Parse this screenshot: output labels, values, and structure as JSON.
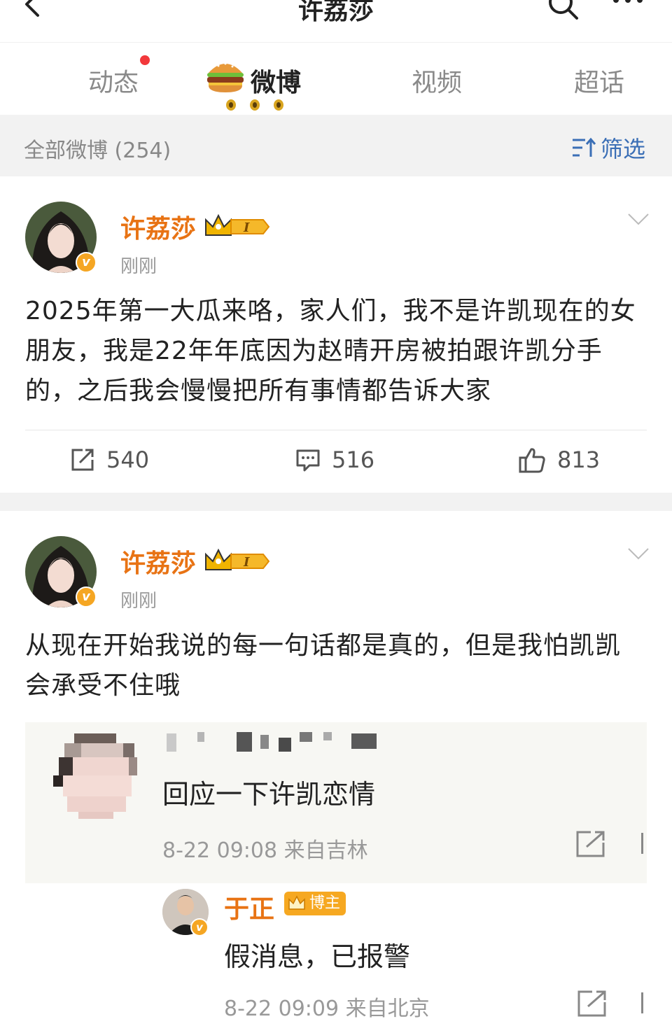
{
  "header": {
    "title": "许荔莎"
  },
  "tabs": [
    {
      "label": "动态",
      "has_dot": true
    },
    {
      "label": "微博",
      "active": true
    },
    {
      "label": "视频"
    },
    {
      "label": "超话"
    }
  ],
  "filterbar": {
    "count_label": "全部微博 (254)",
    "filter_label": "筛选"
  },
  "posts": [
    {
      "author": "许荔莎",
      "time": "刚刚",
      "text": "2025年第一大瓜来咯，家人们，我不是许凯现在的女朋友，我是22年年底因为赵晴开房被拍跟许凯分手的，之后我会慢慢把所有事情都告诉大家",
      "reposts": "540",
      "comments": "516",
      "likes": "813"
    },
    {
      "author": "许荔莎",
      "time": "刚刚",
      "text": "从现在开始我说的每一句话都是真的，但是我怕凯凯会承受不住哦",
      "retweet": {
        "text": "回应一下许凯恋情",
        "meta": "8-22 09:08 来自吉林"
      },
      "reply": {
        "author": "于正",
        "badge": "博主",
        "text": "假消息，已报警",
        "meta": "8-22 09:09 来自北京"
      }
    }
  ],
  "colors": {
    "accent_orange": "#e87314",
    "link_blue": "#3b6fb6",
    "notification_red": "#f2383b",
    "gray_bg": "#f2f2f2"
  }
}
